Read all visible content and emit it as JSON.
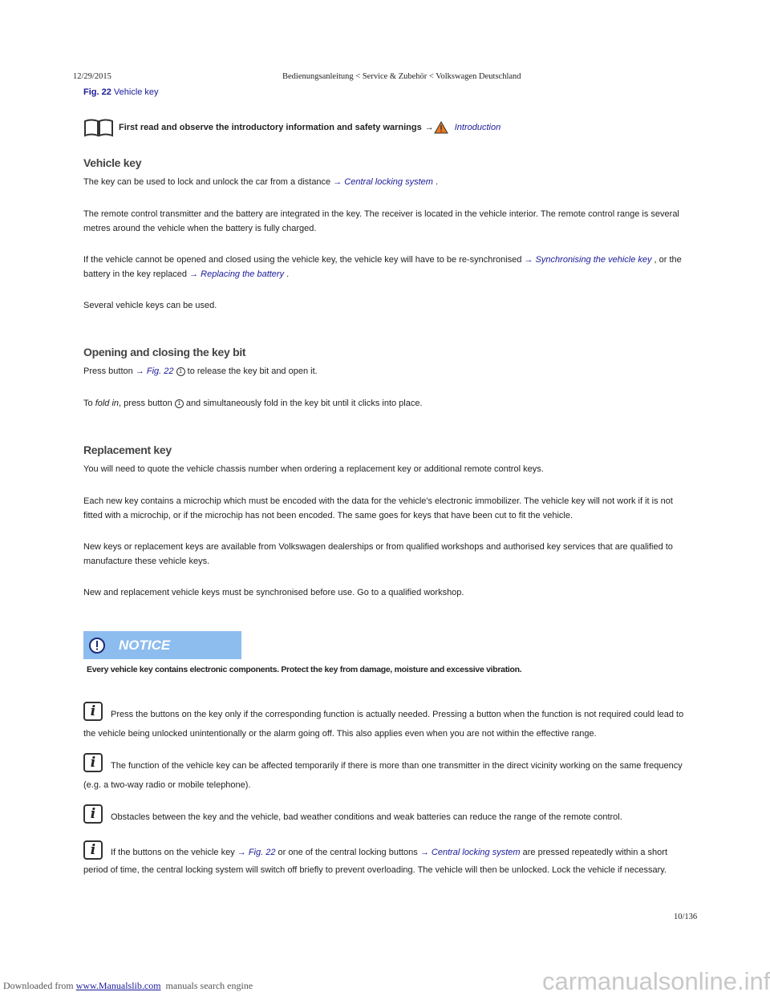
{
  "header": {
    "date": "12/29/2015",
    "title": "Bedienungsanleitung < Service & Zubehör < Volkswagen Deutschland"
  },
  "figure": {
    "label": "Fig. 22",
    "caption": "Vehicle key"
  },
  "intro": {
    "text": "First read and observe the introductory information and safety warnings",
    "arrow": "→",
    "link": "Introduction"
  },
  "sections": {
    "vehicle_key": {
      "title": "Vehicle key",
      "p1a": "The key can be used to lock and unlock the car from a distance ",
      "p1link": "→ Central locking system",
      "p1b": " .",
      "p2": "The remote control transmitter and the battery are integrated in the key. The receiver is located in the vehicle interior. The remote control range is several metres around the vehicle when the battery is fully charged.",
      "p3a": "If the vehicle cannot be opened and closed using the vehicle key, the vehicle key will have to be re-synchronised ",
      "p3link1": "→ Synchronising the vehicle key",
      "p3b": " , or the battery in the key replaced ",
      "p3link2": "→ Replacing the battery",
      "p3c": " .",
      "p4": "Several vehicle keys can be used."
    },
    "key_bit": {
      "title": "Opening and closing the key bit",
      "p1a": "Press button ",
      "p1link": "→ Fig. 22",
      "p1num": "1",
      "p1b": " to release the key bit and open it.",
      "p2a": "To ",
      "p2em": "fold in",
      "p2b": ", press button ",
      "p2num": "1",
      "p2c": " and simultaneously fold in the key bit until it clicks into place."
    },
    "replacement": {
      "title": "Replacement key",
      "p1": "You will need to quote the vehicle chassis number when ordering a replacement key or additional remote control keys.",
      "p2": "Each new key contains a microchip which must be encoded with the data for the vehicle's electronic immobilizer. The vehicle key will not work if it is not fitted with a microchip, or if the microchip has not been encoded. The same goes for keys that have been cut to fit the vehicle.",
      "p3": "New keys or replacement keys are available from Volkswagen dealerships or from qualified workshops and authorised key services that are qualified to manufacture these vehicle keys.",
      "p4": "New and replacement vehicle keys must be synchronised before use. Go to a qualified workshop."
    }
  },
  "notice": {
    "title": "NOTICE",
    "text": "Every vehicle key contains electronic components. Protect the key from damage, moisture and excessive vibration.",
    "color": "#8dbcef"
  },
  "notes": [
    {
      "text": "Press the buttons on the key only if the corresponding function is actually needed. Pressing a button when the function is not required could lead to the vehicle being unlocked unintentionally or the alarm going off. This also applies even when you are not within the effective range."
    },
    {
      "text": "The function of the vehicle key can be affected temporarily if there is more than one transmitter in the direct vicinity working on the same frequency (e.g. a two-way radio or mobile telephone)."
    },
    {
      "text": "Obstacles between the key and the vehicle, bad weather conditions and weak batteries can reduce the range of the remote control."
    },
    {
      "a": "If the buttons on the vehicle key ",
      "link1": "→ Fig. 22",
      "b": " or one of the central locking buttons ",
      "link2": "→ Central locking system",
      "c": " are pressed repeatedly within a short period of time, the central locking system will switch off briefly to prevent overloading. The vehicle will then be unlocked. Lock the vehicle if necessary."
    }
  ],
  "footer": {
    "page": "10/136",
    "downloaded": "Downloaded from",
    "site": "www.Manualslib.com",
    "suffix": "manuals search engine",
    "watermark": "carmanualsonline.info"
  }
}
